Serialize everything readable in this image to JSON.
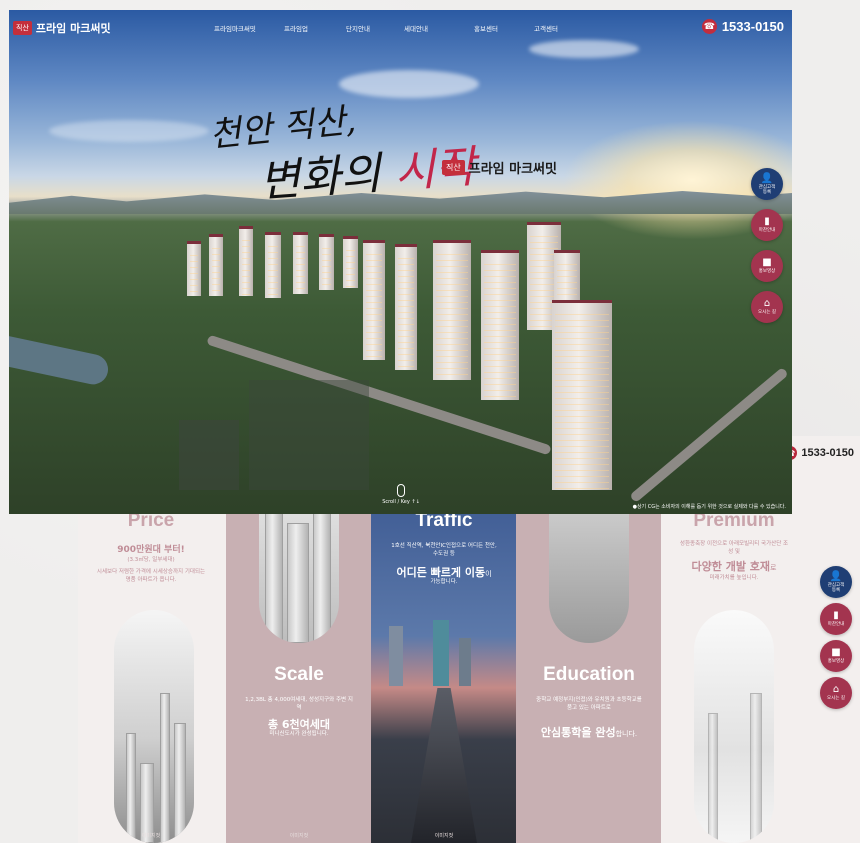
{
  "hero": {
    "logo_tag": "직산",
    "logo_name": "프라임 마크써밋",
    "menu": [
      "프라임마크써밋",
      "프라임업",
      "단지안내",
      "세대안내",
      "홍보센터",
      "고객센터"
    ],
    "phone": "1533-0150",
    "slogan_line1": "천안 직산,",
    "slogan_line2_a": "변화의 ",
    "slogan_line2_b": "시작",
    "brand_tag": "직산",
    "brand_name": "프라임 마크써밋",
    "scroll_label": "Scroll / Key ↑↓",
    "notice": "●상기 CG는 소비자의 이해를 돕기 위한 것으로 실제와 다를 수 있습니다."
  },
  "sidebar": {
    "items": [
      {
        "label": "관심고객\n등록",
        "icon": "user-icon",
        "color": "#1f3e74"
      },
      {
        "label": "마찬안내",
        "icon": "document-icon",
        "color": "#a3344f"
      },
      {
        "label": "홍보영상",
        "icon": "video-icon",
        "color": "#a3344f"
      },
      {
        "label": "오시는 길",
        "icon": "map-icon",
        "color": "#a3344f"
      }
    ]
  },
  "lower": {
    "phone": "1533-0150",
    "columns": [
      {
        "title": "Price",
        "lead": "900만원대 부터!",
        "sub": "(3.3㎡당, 일부세대)",
        "desc": "시세보다 저렴한 가격에 시세상승까지 기대되는 명품 아파트가 옵니다.",
        "caption": "이미지컷"
      },
      {
        "title": "Scale",
        "desc": "1,2,3BL 총 4,000여세대, 성성지구와 주변 지역",
        "big": "총 6천여세대",
        "desc2": "미니신도시가 완성됩니다.",
        "caption": "이미지컷"
      },
      {
        "title": "Traffic",
        "desc": "1호선 직산역, 북천안IC인접으로 어디든 천안, 수도권 등",
        "big": "어디든 빠르게 이동",
        "big_suffix": "이",
        "desc2": "가능합니다.",
        "caption": "이미지컷"
      },
      {
        "title": "Education",
        "desc": "중학교 예정부지(인접)와 유치원과 초등학교를 품고 있는 아파트로",
        "big": "안심통학을 완성",
        "big_suffix": "합니다.",
        "caption": "이미지컷"
      },
      {
        "title": "Premium",
        "desc": "성환종축장 이전으로 아래모빌리티 국가산단 조성 및",
        "big": "다양한 개발 호재",
        "big_suffix": "로",
        "desc2": "미래가치를 높입니다."
      }
    ],
    "sidebar_labels": [
      "관심고객\n등록",
      "마찬안내",
      "홍보영상",
      "오시는 길"
    ]
  }
}
